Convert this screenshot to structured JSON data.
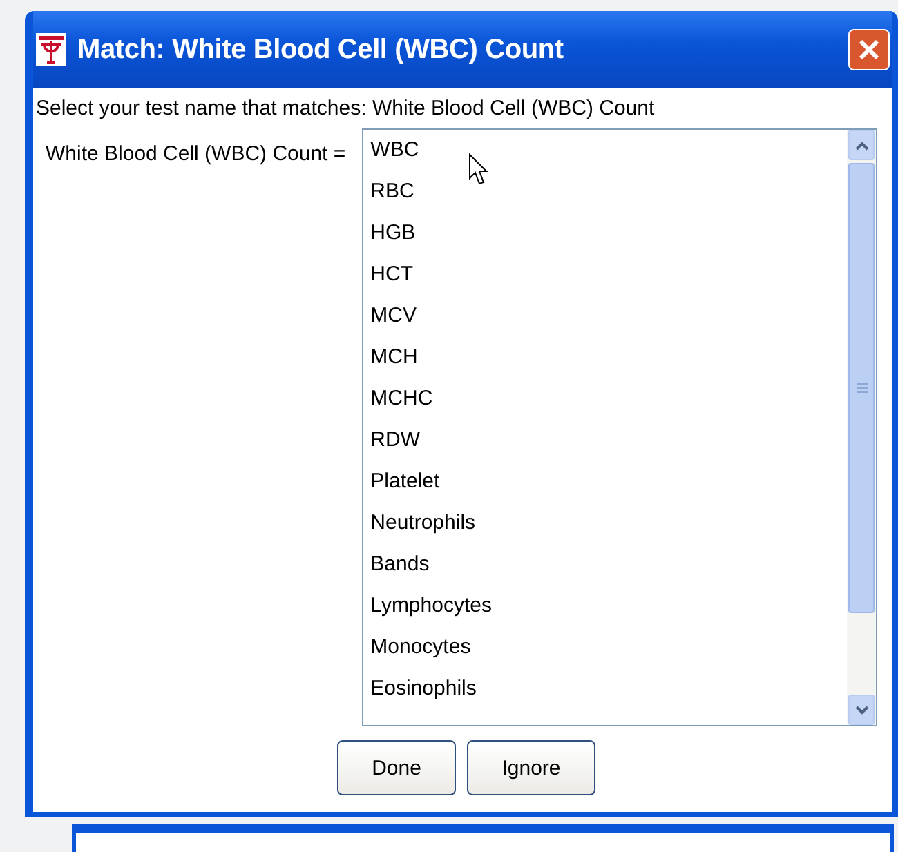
{
  "window": {
    "title": "Match: White Blood Cell (WBC) Count"
  },
  "prompt": "Select your test name that matches: White Blood Cell (WBC) Count",
  "field_label": "White Blood Cell (WBC) Count =",
  "test_list": {
    "items": [
      "WBC",
      "RBC",
      "HGB",
      "HCT",
      "MCV",
      "MCH",
      "MCHC",
      "RDW",
      "Platelet",
      "Neutrophils",
      "Bands",
      "Lymphocytes",
      "Monocytes",
      "Eosinophils"
    ]
  },
  "buttons": [
    "Done",
    "Ignore"
  ]
}
